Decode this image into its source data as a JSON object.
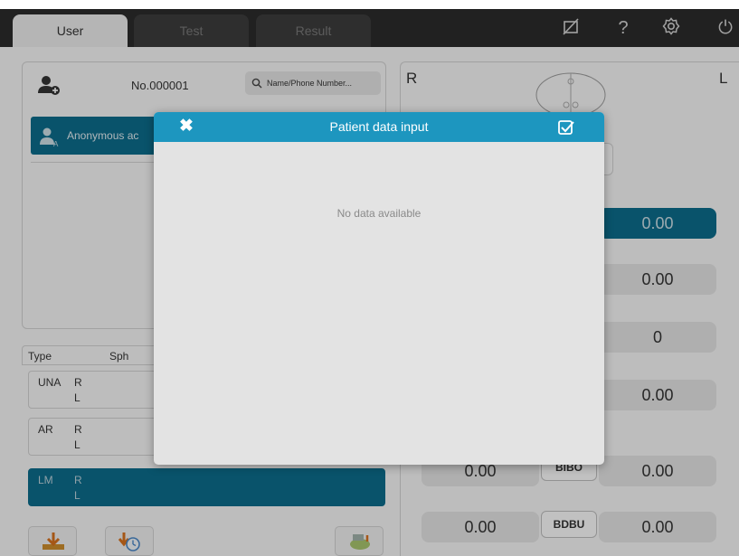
{
  "tabs": [
    {
      "label": "User",
      "active": true
    },
    {
      "label": "Test",
      "active": false
    },
    {
      "label": "Result",
      "active": false
    }
  ],
  "top_icons": [
    "no-print-icon",
    "help-icon",
    "settings-icon",
    "power-icon"
  ],
  "top_icon_glyphs": {
    "help": "?",
    "power": "⏻"
  },
  "user_panel": {
    "patient_no": "No.000001",
    "search_placeholder": "Name/Phone Number...",
    "anonymous_label": "Anonymous ac"
  },
  "measure_table": {
    "headers": {
      "type": "Type",
      "sph": "Sph"
    },
    "rows": [
      {
        "type": "UNA",
        "r": "R",
        "l": "L",
        "active": false
      },
      {
        "type": "AR",
        "r": "R",
        "l": "L",
        "active": false
      },
      {
        "type": "LM",
        "r": "R",
        "l": "L",
        "active": true
      }
    ]
  },
  "right_panel": {
    "right_eye": "R",
    "left_eye": "L",
    "values_right_column": [
      "0.00",
      "0.00",
      "0",
      "0.00",
      "0.00",
      "0.00"
    ],
    "partial_left_values": [
      "0.00",
      "0.00"
    ],
    "buttons": [
      "BIBO",
      "BDBU"
    ]
  },
  "dialog": {
    "title": "Patient data input",
    "empty_message": "No data available",
    "close_glyph": "✖"
  },
  "colors": {
    "accent_dark": "#0c6b8a",
    "dialog_header": "#1d96bf",
    "topbar": "#2b2b2b"
  }
}
